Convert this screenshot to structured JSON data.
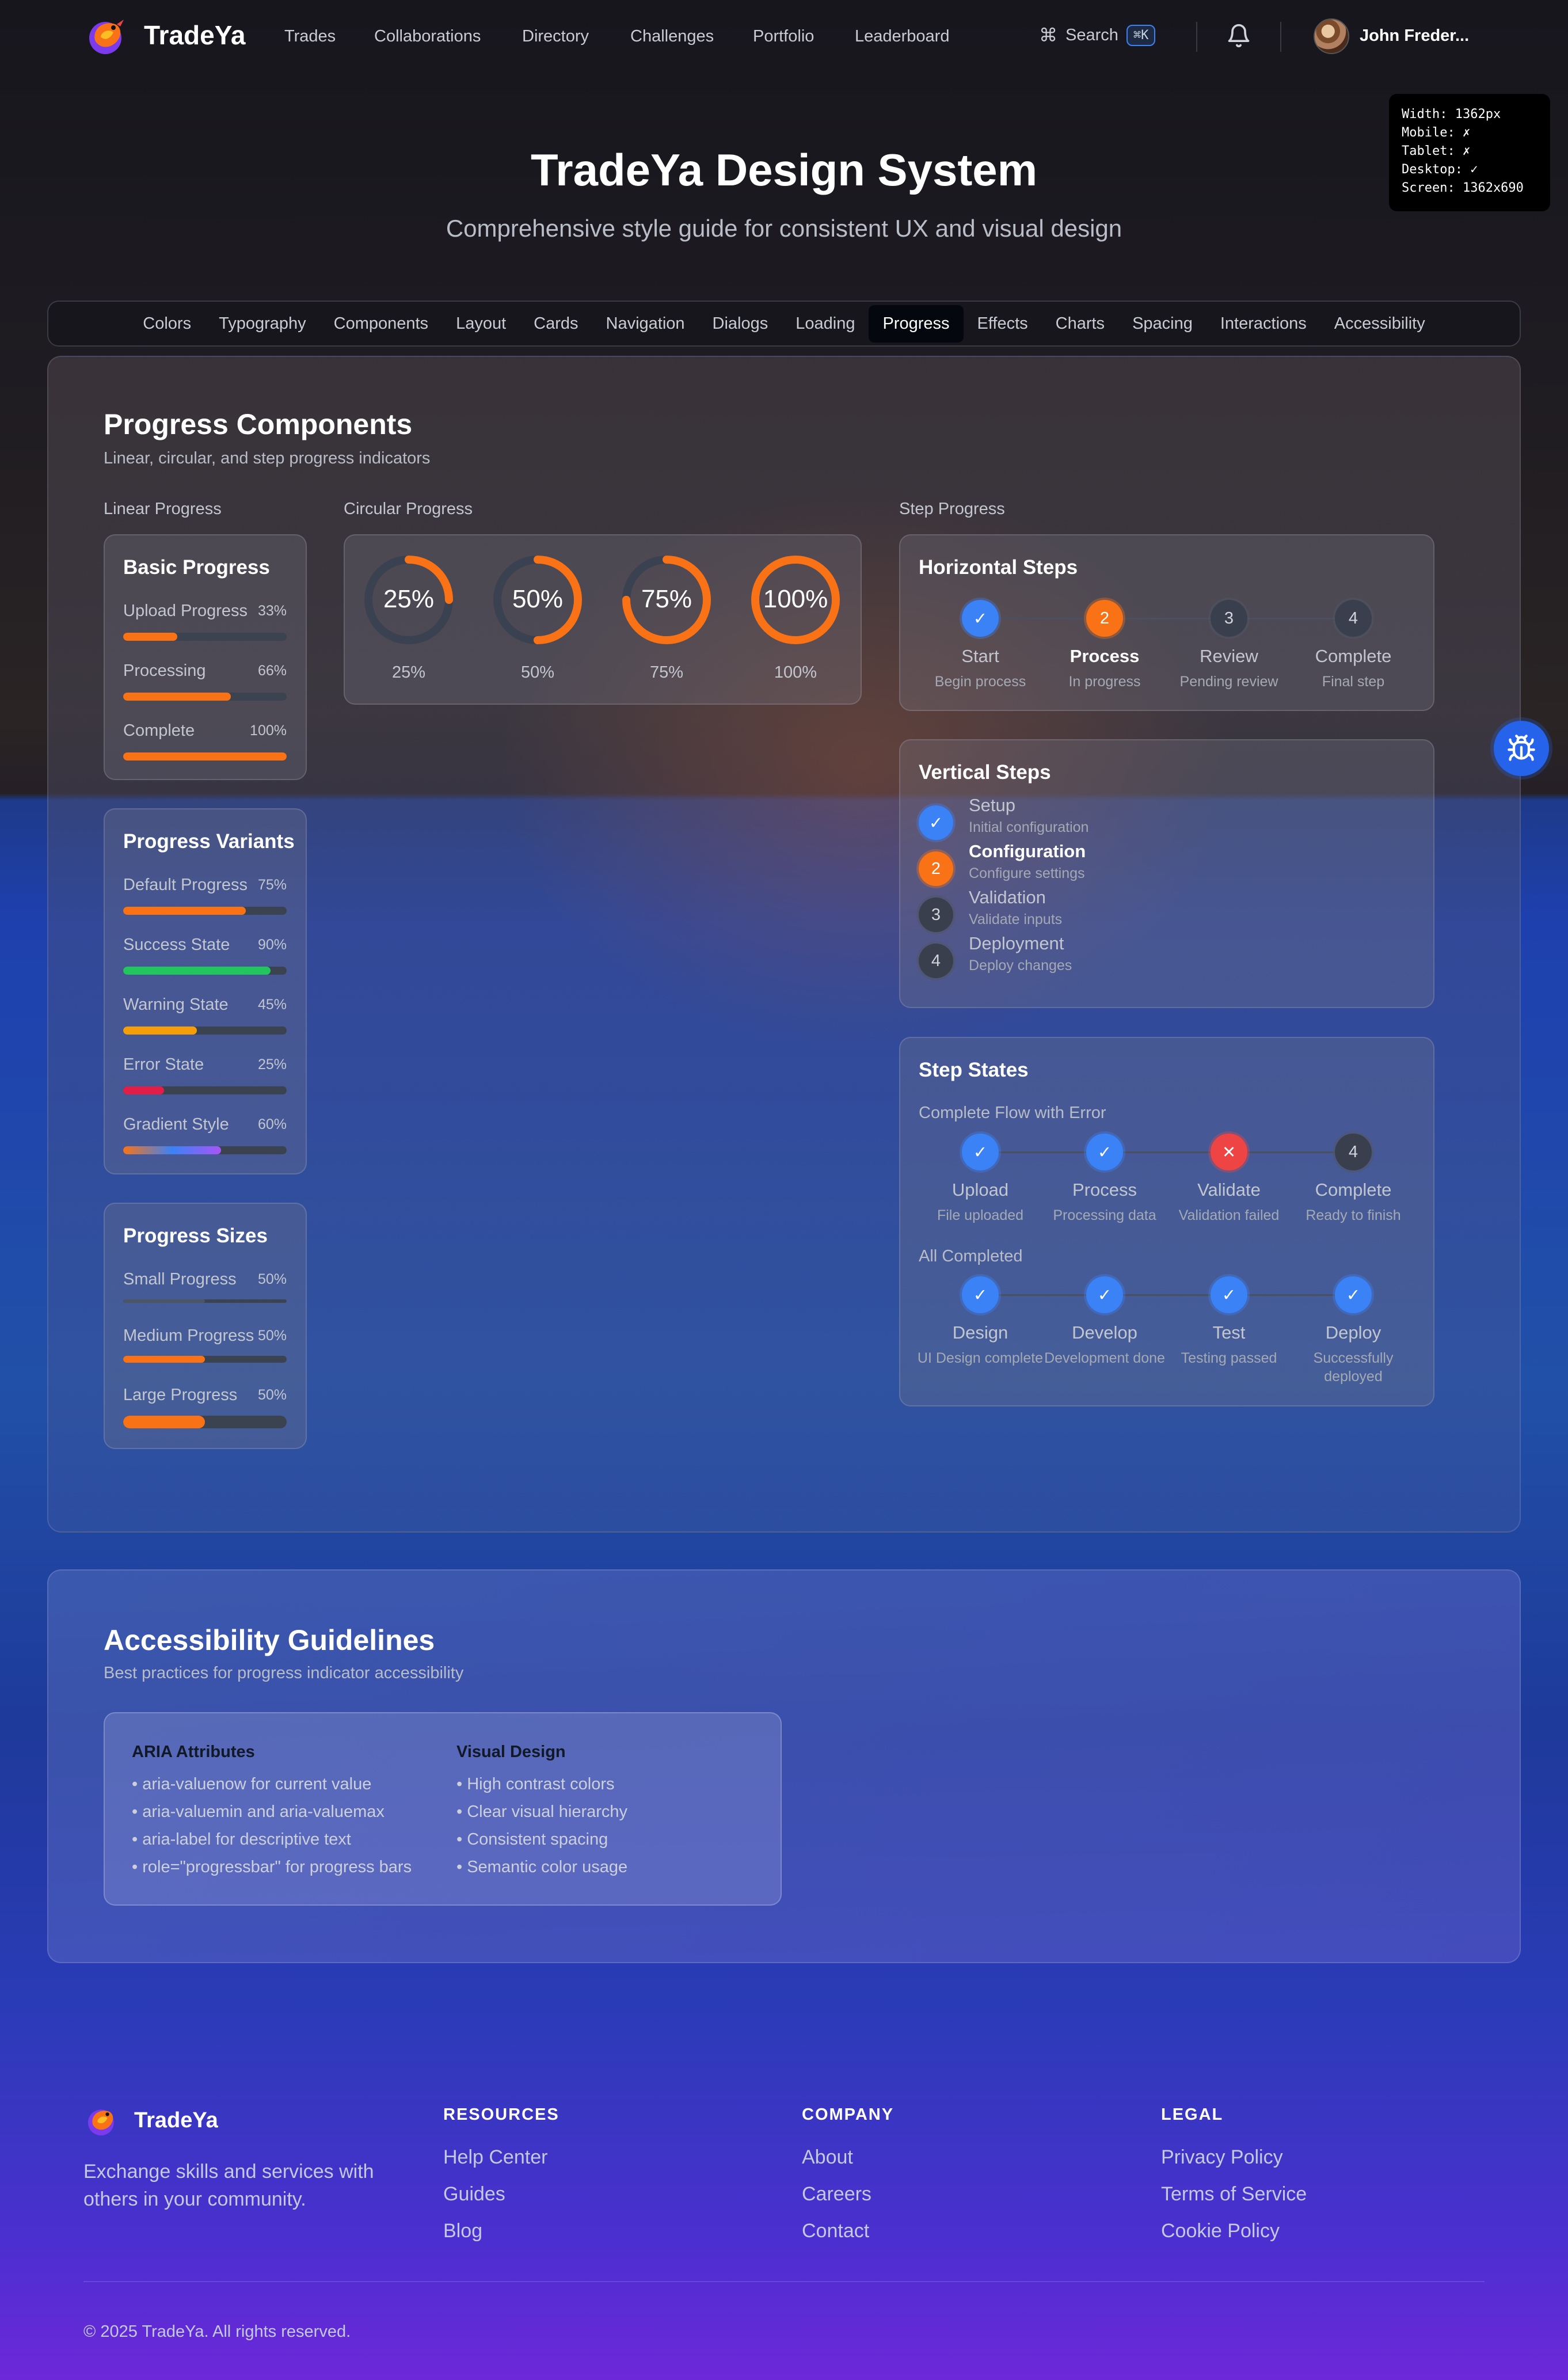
{
  "nav": {
    "brand": "TradeYa",
    "links": [
      "Trades",
      "Collaborations",
      "Directory",
      "Challenges",
      "Portfolio",
      "Leaderboard"
    ],
    "search_label": "Search",
    "search_shortcut": "⌘K",
    "user_name": "John Freder..."
  },
  "debug": {
    "width": "Width: 1362px",
    "mobile": "Mobile: ✗",
    "tablet": "Tablet: ✗",
    "desktop": "Desktop: ✓",
    "screen": "Screen: 1362x690"
  },
  "hero": {
    "title": "TradeYa Design System",
    "subtitle": "Comprehensive style guide for consistent UX and visual design"
  },
  "tabs": [
    "Colors",
    "Typography",
    "Components",
    "Layout",
    "Cards",
    "Navigation",
    "Dialogs",
    "Loading",
    "Progress",
    "Effects",
    "Charts",
    "Spacing",
    "Interactions",
    "Accessibility"
  ],
  "active_tab": "Progress",
  "progress": {
    "title": "Progress Components",
    "subtitle": "Linear, circular, and step progress indicators",
    "linear_head": "Linear Progress",
    "circular_head": "Circular Progress",
    "step_head": "Step Progress",
    "basic": {
      "title": "Basic Progress",
      "items": [
        {
          "label": "Upload Progress",
          "value": "33%",
          "fraction": 0.33
        },
        {
          "label": "Processing",
          "value": "66%",
          "fraction": 0.66
        },
        {
          "label": "Complete",
          "value": "100%",
          "fraction": 1.0
        }
      ]
    },
    "variants": {
      "title": "Progress Variants",
      "items": [
        {
          "label": "Default Progress",
          "value": "75%",
          "fraction": 0.75,
          "color": "#f97316"
        },
        {
          "label": "Success State",
          "value": "90%",
          "fraction": 0.9,
          "color": "#22c55e"
        },
        {
          "label": "Warning State",
          "value": "45%",
          "fraction": 0.45,
          "color": "#f59e0b"
        },
        {
          "label": "Error State",
          "value": "25%",
          "fraction": 0.25,
          "color": "#e11d48"
        },
        {
          "label": "Gradient Style",
          "value": "60%",
          "fraction": 0.6,
          "color": "gradient"
        }
      ]
    },
    "sizes": {
      "title": "Progress Sizes",
      "items": [
        {
          "label": "Small Progress",
          "value": "50%",
          "fraction": 0.5
        },
        {
          "label": "Medium Progress",
          "value": "50%",
          "fraction": 0.5
        },
        {
          "label": "Large Progress",
          "value": "50%",
          "fraction": 0.5
        }
      ]
    },
    "circular": [
      {
        "label": "25%",
        "caption": "25%",
        "fraction": 0.25
      },
      {
        "label": "50%",
        "caption": "50%",
        "fraction": 0.5
      },
      {
        "label": "75%",
        "caption": "75%",
        "fraction": 0.75
      },
      {
        "label": "100%",
        "caption": "100%",
        "fraction": 1.0
      }
    ],
    "horizontal": {
      "title": "Horizontal Steps",
      "steps": [
        {
          "mark": "✓",
          "title": "Start",
          "desc": "Begin process",
          "state": "done"
        },
        {
          "mark": "2",
          "title": "Process",
          "desc": "In progress",
          "state": "current"
        },
        {
          "mark": "3",
          "title": "Review",
          "desc": "Pending review",
          "state": "pending"
        },
        {
          "mark": "4",
          "title": "Complete",
          "desc": "Final step",
          "state": "pending"
        }
      ]
    },
    "vertical": {
      "title": "Vertical Steps",
      "steps": [
        {
          "mark": "✓",
          "title": "Setup",
          "desc": "Initial configuration",
          "state": "done"
        },
        {
          "mark": "2",
          "title": "Configuration",
          "desc": "Configure settings",
          "state": "current"
        },
        {
          "mark": "3",
          "title": "Validation",
          "desc": "Validate inputs",
          "state": "pending"
        },
        {
          "mark": "4",
          "title": "Deployment",
          "desc": "Deploy changes",
          "state": "pending"
        }
      ]
    },
    "states": {
      "title": "Step States",
      "error_flow_label": "Complete Flow with Error",
      "error_flow": [
        {
          "mark": "✓",
          "title": "Upload",
          "desc": "File uploaded",
          "state": "done"
        },
        {
          "mark": "✓",
          "title": "Process",
          "desc": "Processing data",
          "state": "done"
        },
        {
          "mark": "✕",
          "title": "Validate",
          "desc": "Validation failed",
          "state": "error"
        },
        {
          "mark": "4",
          "title": "Complete",
          "desc": "Ready to finish",
          "state": "pending"
        }
      ],
      "done_flow_label": "All Completed",
      "done_flow": [
        {
          "mark": "✓",
          "title": "Design",
          "desc": "UI Design complete",
          "state": "done"
        },
        {
          "mark": "✓",
          "title": "Develop",
          "desc": "Development done",
          "state": "done"
        },
        {
          "mark": "✓",
          "title": "Test",
          "desc": "Testing passed",
          "state": "done"
        },
        {
          "mark": "✓",
          "title": "Deploy",
          "desc": "Successfully deployed",
          "state": "done"
        }
      ]
    }
  },
  "a11y": {
    "title": "Accessibility Guidelines",
    "subtitle": "Best practices for progress indicator accessibility",
    "aria_head": "ARIA Attributes",
    "aria_items": [
      "• aria-valuenow for current value",
      "• aria-valuemin and aria-valuemax",
      "• aria-label for descriptive text",
      "• role=\"progressbar\" for progress bars"
    ],
    "visual_head": "Visual Design",
    "visual_items": [
      "• High contrast colors",
      "• Clear visual hierarchy",
      "• Consistent spacing",
      "• Semantic color usage"
    ]
  },
  "footer": {
    "brand": "TradeYa",
    "desc": "Exchange skills and services with others in your community.",
    "resources_head": "RESOURCES",
    "resources": [
      "Help Center",
      "Guides",
      "Blog"
    ],
    "company_head": "COMPANY",
    "company": [
      "About",
      "Careers",
      "Contact"
    ],
    "legal_head": "LEGAL",
    "legal": [
      "Privacy Policy",
      "Terms of Service",
      "Cookie Policy"
    ],
    "copyright": "© 2025 TradeYa. All rights reserved."
  }
}
